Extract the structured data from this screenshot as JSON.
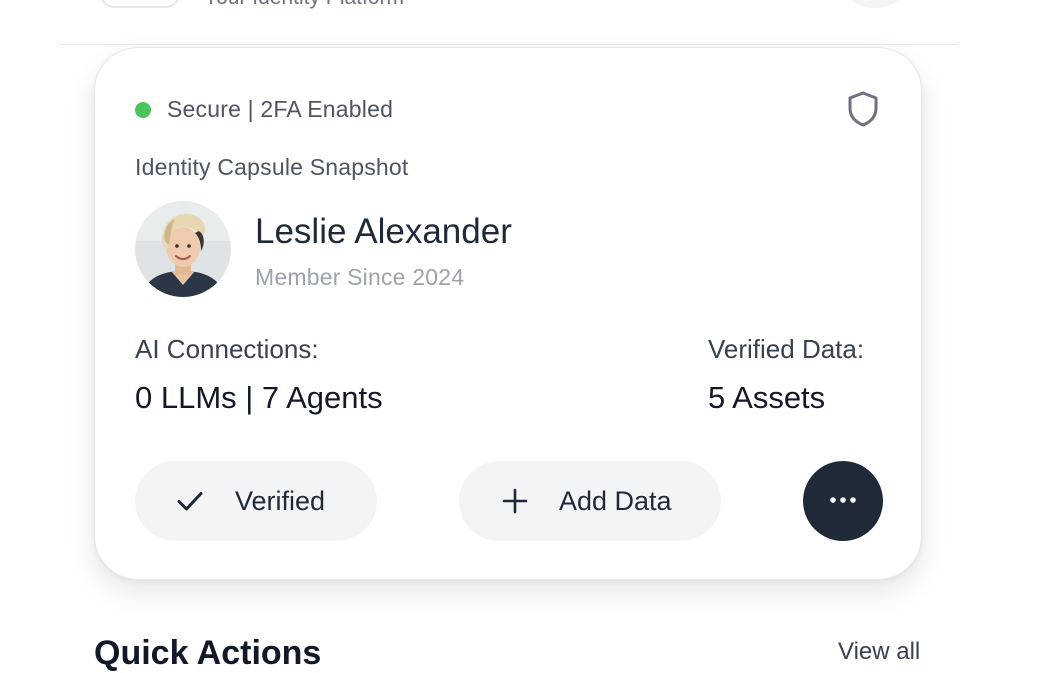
{
  "header": {
    "tagline": "Your Identity Platform"
  },
  "card": {
    "status_text": "Secure | 2FA Enabled",
    "status_color": "#4ac55c",
    "status_icon": "shield-icon",
    "heading": "Identity Capsule Snapshot",
    "user": {
      "name": "Leslie Alexander",
      "member_since": "Member Since 2024",
      "avatar_icon": "avatar"
    },
    "stats": {
      "ai_connections_label": "AI Connections:",
      "ai_connections_value": "0 LLMs | 7 Agents",
      "verified_data_label": "Verified Data:",
      "verified_data_value": "5 Assets"
    },
    "actions": {
      "verified_label": "Verified",
      "verified_icon": "check-icon",
      "add_label": "Add Data",
      "add_icon": "plus-icon",
      "more_icon": "more-icon"
    }
  },
  "section": {
    "heading": "Quick Actions",
    "link": "View all"
  },
  "colors": {
    "accent_dark": "#1f2937",
    "pill_bg": "#f3f4f6",
    "muted_text": "#9ca3af"
  }
}
